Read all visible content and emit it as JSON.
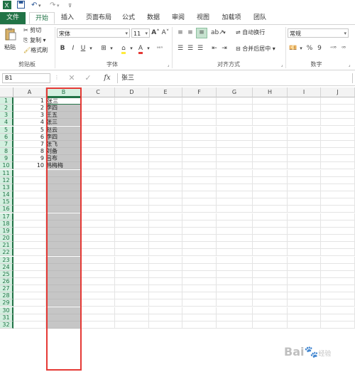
{
  "tabs": [
    "文件",
    "开始",
    "插入",
    "页面布局",
    "公式",
    "数据",
    "审阅",
    "视图",
    "加载项",
    "团队"
  ],
  "clipboard": {
    "paste": "粘贴",
    "cut": "剪切",
    "copy": "复制",
    "format_painter": "格式刷",
    "group": "剪贴板"
  },
  "font": {
    "name": "宋体",
    "size": "11",
    "group": "字体",
    "bold": "B",
    "italic": "I",
    "underline": "U"
  },
  "alignment": {
    "wrap": "自动换行",
    "merge": "合并后居中",
    "group": "对齐方式"
  },
  "number": {
    "format": "常规",
    "percent": "%",
    "comma": "9",
    "group": "数字"
  },
  "formula_bar": {
    "name_box": "B1",
    "fx": "fx",
    "content": "张三"
  },
  "columns": [
    "A",
    "B",
    "C",
    "D",
    "E",
    "F",
    "G",
    "H",
    "I",
    "J"
  ],
  "rows": [
    "1",
    "2",
    "3",
    "4",
    "5",
    "6",
    "7",
    "8",
    "9",
    "10",
    "11",
    "12",
    "13",
    "14",
    "15",
    "16",
    "17",
    "18",
    "19",
    "20",
    "21",
    "22",
    "23",
    "24",
    "25",
    "26",
    "27",
    "28",
    "29",
    "30",
    "31",
    "32"
  ],
  "data": {
    "colA": [
      "1",
      "2",
      "3",
      "4",
      "5",
      "6",
      "7",
      "8",
      "9",
      "10"
    ],
    "colB": [
      "张三",
      "李四",
      "王五",
      "张三",
      "赵云",
      "李四",
      "张飞",
      "刘备",
      "吕布",
      "韩梅梅"
    ]
  },
  "watermark": {
    "brand": "Bai",
    "suffix": "经验"
  },
  "accent_color": "#217346",
  "highlight_color": "#e53935"
}
